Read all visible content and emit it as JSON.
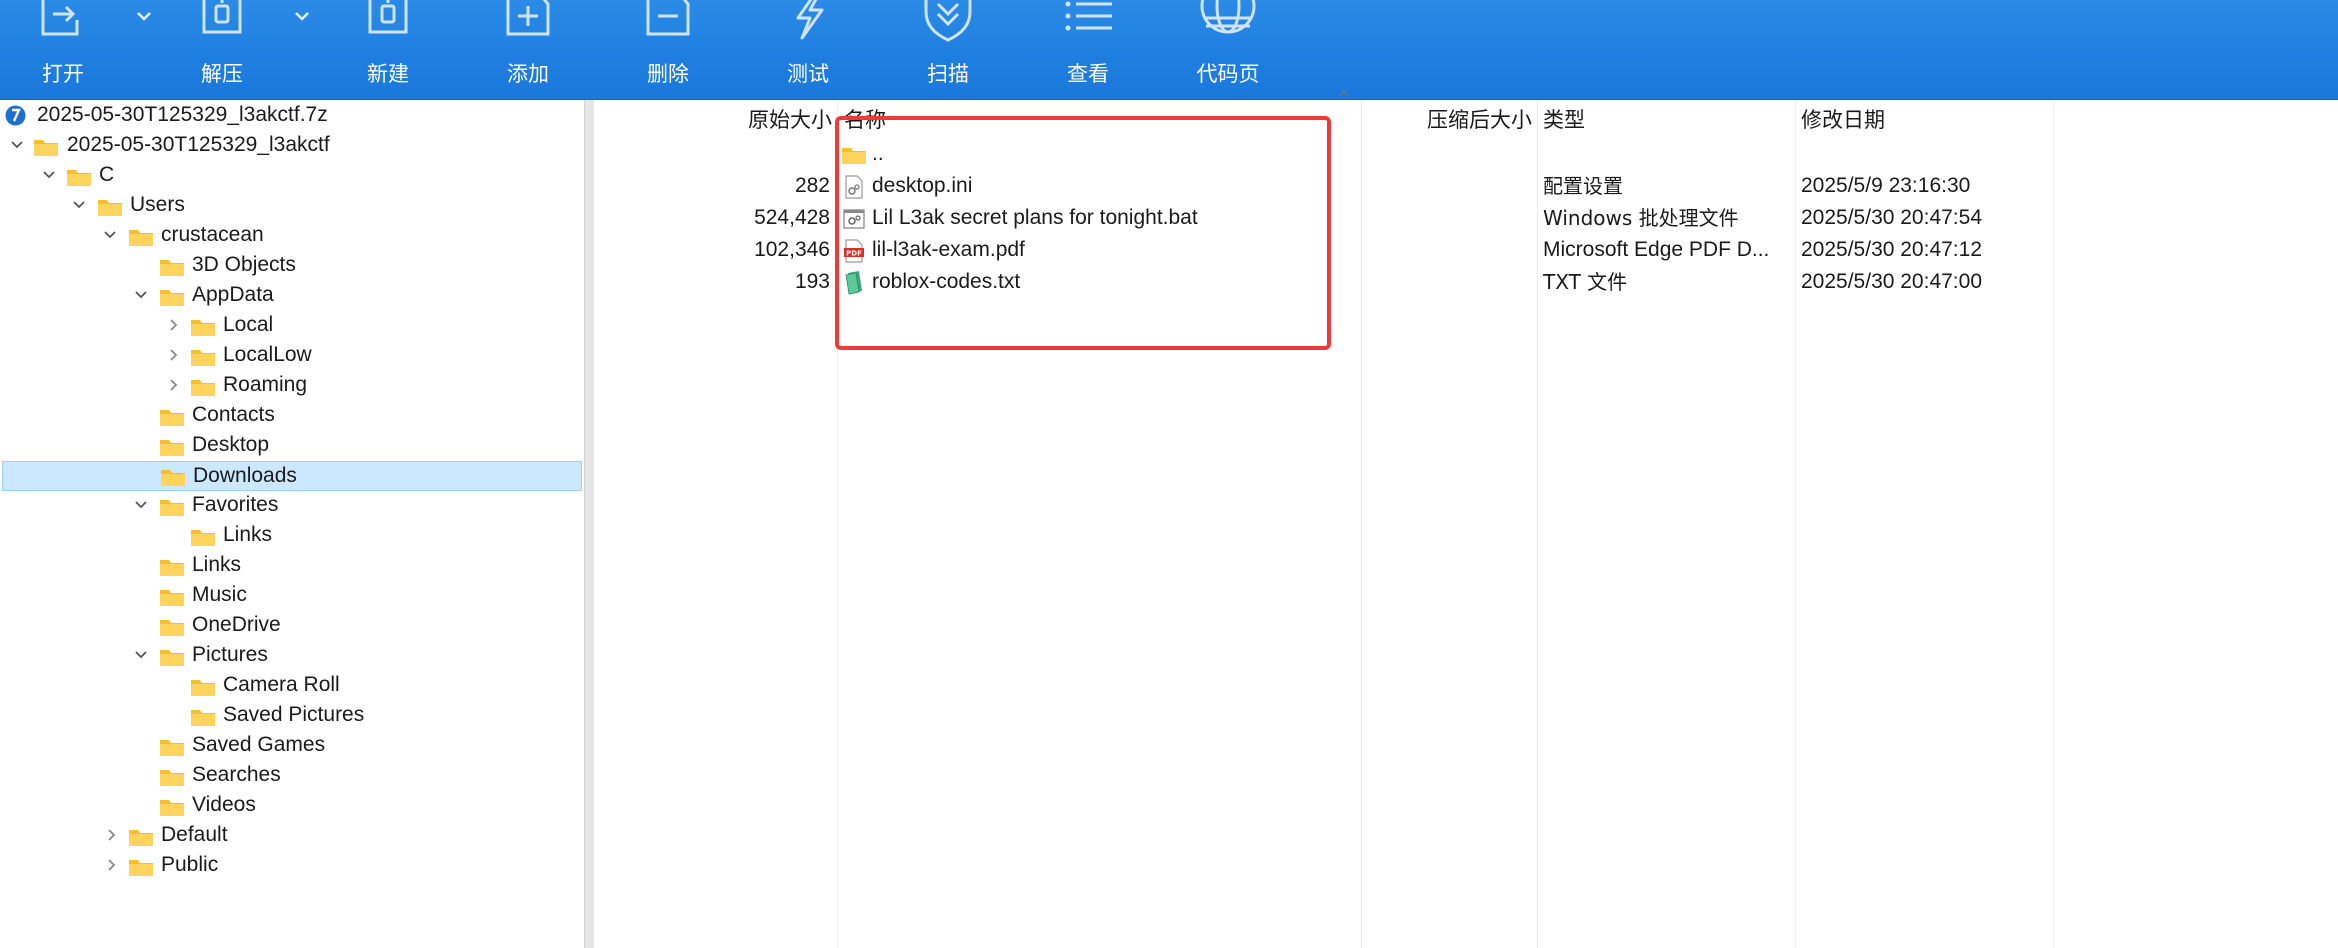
{
  "toolbar": {
    "buttons": [
      {
        "id": "open",
        "label": "打开"
      },
      {
        "id": "extract",
        "label": "解压"
      },
      {
        "id": "new",
        "label": "新建"
      },
      {
        "id": "add",
        "label": "添加"
      },
      {
        "id": "delete",
        "label": "删除"
      },
      {
        "id": "test",
        "label": "测试"
      },
      {
        "id": "scan",
        "label": "扫描"
      },
      {
        "id": "view",
        "label": "查看"
      },
      {
        "id": "codepage",
        "label": "代码页"
      }
    ]
  },
  "tree": {
    "items": [
      {
        "label": "2025-05-30T125329_l3akctf.7z",
        "icon": "archive-7z-icon"
      },
      {
        "label": "2025-05-30T125329_l3akctf",
        "icon": "folder-icon",
        "expanded": true
      },
      {
        "label": "C",
        "icon": "folder-icon",
        "expanded": true
      },
      {
        "label": "Users",
        "icon": "folder-icon",
        "expanded": true
      },
      {
        "label": "crustacean",
        "icon": "folder-icon",
        "expanded": true
      },
      {
        "label": "3D Objects",
        "icon": "folder-icon"
      },
      {
        "label": "AppData",
        "icon": "folder-icon",
        "expanded": true
      },
      {
        "label": "Local",
        "icon": "folder-icon",
        "collapsed": true
      },
      {
        "label": "LocalLow",
        "icon": "folder-icon",
        "collapsed": true
      },
      {
        "label": "Roaming",
        "icon": "folder-icon",
        "collapsed": true
      },
      {
        "label": "Contacts",
        "icon": "folder-icon"
      },
      {
        "label": "Desktop",
        "icon": "folder-icon"
      },
      {
        "label": "Downloads",
        "icon": "folder-icon",
        "selected": true
      },
      {
        "label": "Favorites",
        "icon": "folder-icon",
        "expanded": true
      },
      {
        "label": "Links",
        "icon": "folder-icon"
      },
      {
        "label": "Links",
        "icon": "folder-icon"
      },
      {
        "label": "Music",
        "icon": "folder-icon"
      },
      {
        "label": "OneDrive",
        "icon": "folder-icon"
      },
      {
        "label": "Pictures",
        "icon": "folder-icon",
        "expanded": true
      },
      {
        "label": "Camera Roll",
        "icon": "folder-icon"
      },
      {
        "label": "Saved Pictures",
        "icon": "folder-icon"
      },
      {
        "label": "Saved Games",
        "icon": "folder-icon"
      },
      {
        "label": "Searches",
        "icon": "folder-icon"
      },
      {
        "label": "Videos",
        "icon": "folder-icon"
      },
      {
        "label": "Default",
        "icon": "folder-icon",
        "collapsed": true
      },
      {
        "label": "Public",
        "icon": "folder-icon",
        "collapsed": true
      }
    ]
  },
  "list": {
    "columns": {
      "size": "原始大小",
      "name": "名称",
      "packed": "压缩后大小",
      "type": "类型",
      "modified": "修改日期"
    },
    "sort_indicator": "^",
    "rows": [
      {
        "size": "",
        "name": "..",
        "type": "",
        "modified": "",
        "icon": "folder-up-icon"
      },
      {
        "size": "282",
        "name": "desktop.ini",
        "type": "配置设置",
        "modified": "2025/5/9 23:16:30",
        "icon": "ini-file-icon"
      },
      {
        "size": "524,428",
        "name": "Lil L3ak secret plans for tonight.bat",
        "type": "Windows 批处理文件",
        "modified": "2025/5/30 20:47:54",
        "icon": "bat-file-icon"
      },
      {
        "size": "102,346",
        "name": "lil-l3ak-exam.pdf",
        "type": "Microsoft Edge PDF D...",
        "modified": "2025/5/30 20:47:12",
        "icon": "pdf-file-icon"
      },
      {
        "size": "193",
        "name": "roblox-codes.txt",
        "type": "TXT 文件",
        "modified": "2025/5/30 20:47:00",
        "icon": "txt-file-icon"
      }
    ]
  },
  "colors": {
    "toolbar_bg": "#1f7fe0",
    "selection_bg": "#cce8ff",
    "highlight_border": "#ee3a3a",
    "folder": "#ffc83d"
  }
}
